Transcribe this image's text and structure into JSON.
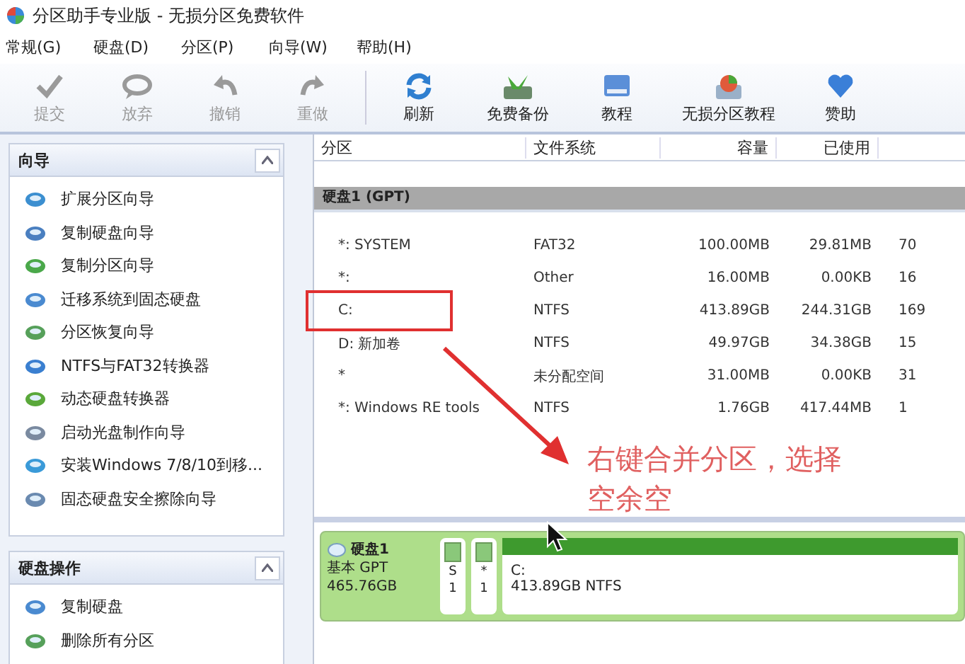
{
  "window": {
    "title": "分区助手专业版 - 无损分区免费软件"
  },
  "menu": [
    "常规(G)",
    "硬盘(D)",
    "分区(P)",
    "向导(W)",
    "帮助(H)"
  ],
  "toolbar": [
    {
      "label": "提交",
      "disabled": true
    },
    {
      "label": "放弃",
      "disabled": true
    },
    {
      "label": "撤销",
      "disabled": true
    },
    {
      "label": "重做",
      "disabled": true
    },
    {
      "label": "刷新",
      "disabled": false
    },
    {
      "label": "免费备份",
      "disabled": false
    },
    {
      "label": "教程",
      "disabled": false
    },
    {
      "label": "无损分区教程",
      "disabled": false
    },
    {
      "label": "赞助",
      "disabled": false
    }
  ],
  "sidebar": [
    {
      "title": "向导",
      "expanded": true,
      "items": [
        "扩展分区向导",
        "复制硬盘向导",
        "复制分区向导",
        "迁移系统到固态硬盘",
        "分区恢复向导",
        "NTFS与FAT32转换器",
        "动态硬盘转换器",
        "启动光盘制作向导",
        "安装Windows 7/8/10到移...",
        "固态硬盘安全擦除向导"
      ]
    },
    {
      "title": "硬盘操作",
      "expanded": true,
      "items": [
        "复制硬盘",
        "删除所有分区"
      ]
    }
  ],
  "table": {
    "columns": [
      "分区",
      "文件系统",
      "容量",
      "已使用"
    ],
    "group": "硬盘1 (GPT)",
    "rows": [
      [
        "*: SYSTEM",
        "FAT32",
        "100.00MB",
        "29.81MB",
        "70"
      ],
      [
        "*:",
        "Other",
        "16.00MB",
        "0.00KB",
        "16"
      ],
      [
        "C:",
        "NTFS",
        "413.89GB",
        "244.31GB",
        "169"
      ],
      [
        "D: 新加卷",
        "NTFS",
        "49.97GB",
        "34.38GB",
        "15"
      ],
      [
        "*",
        "未分配空间",
        "31.00MB",
        "0.00KB",
        "31"
      ],
      [
        "*: Windows RE tools",
        "NTFS",
        "1.76GB",
        "417.44MB",
        "1"
      ]
    ]
  },
  "disk_map": {
    "name": "硬盘1",
    "type": "基本 GPT",
    "size": "465.76GB",
    "partitions": [
      {
        "label": "S",
        "number": "1"
      },
      {
        "label": "*",
        "number": "1"
      }
    ],
    "main": {
      "label": "C:",
      "detail": "413.89GB NTFS"
    }
  },
  "annotation": {
    "lines": [
      "右键合并分区，选择",
      "空余空"
    ]
  }
}
